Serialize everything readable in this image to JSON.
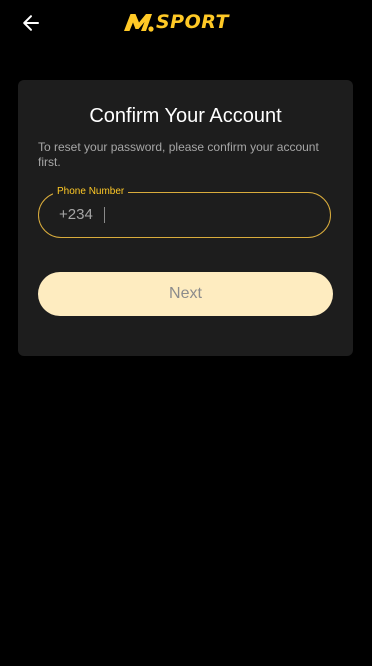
{
  "header": {
    "back_icon": "arrow-left-icon",
    "logo_text": "SPORT",
    "brand_color": "#FFC926"
  },
  "card": {
    "title": "Confirm Your Account",
    "description": "To reset your password, please confirm your account first.",
    "phone_field": {
      "label": "Phone Number",
      "country_code": "+234",
      "value": "",
      "placeholder": ""
    },
    "next_label": "Next"
  },
  "colors": {
    "background": "#000000",
    "card": "#1D1D1D",
    "accent": "#FFC926",
    "button": "#FEECC0"
  }
}
